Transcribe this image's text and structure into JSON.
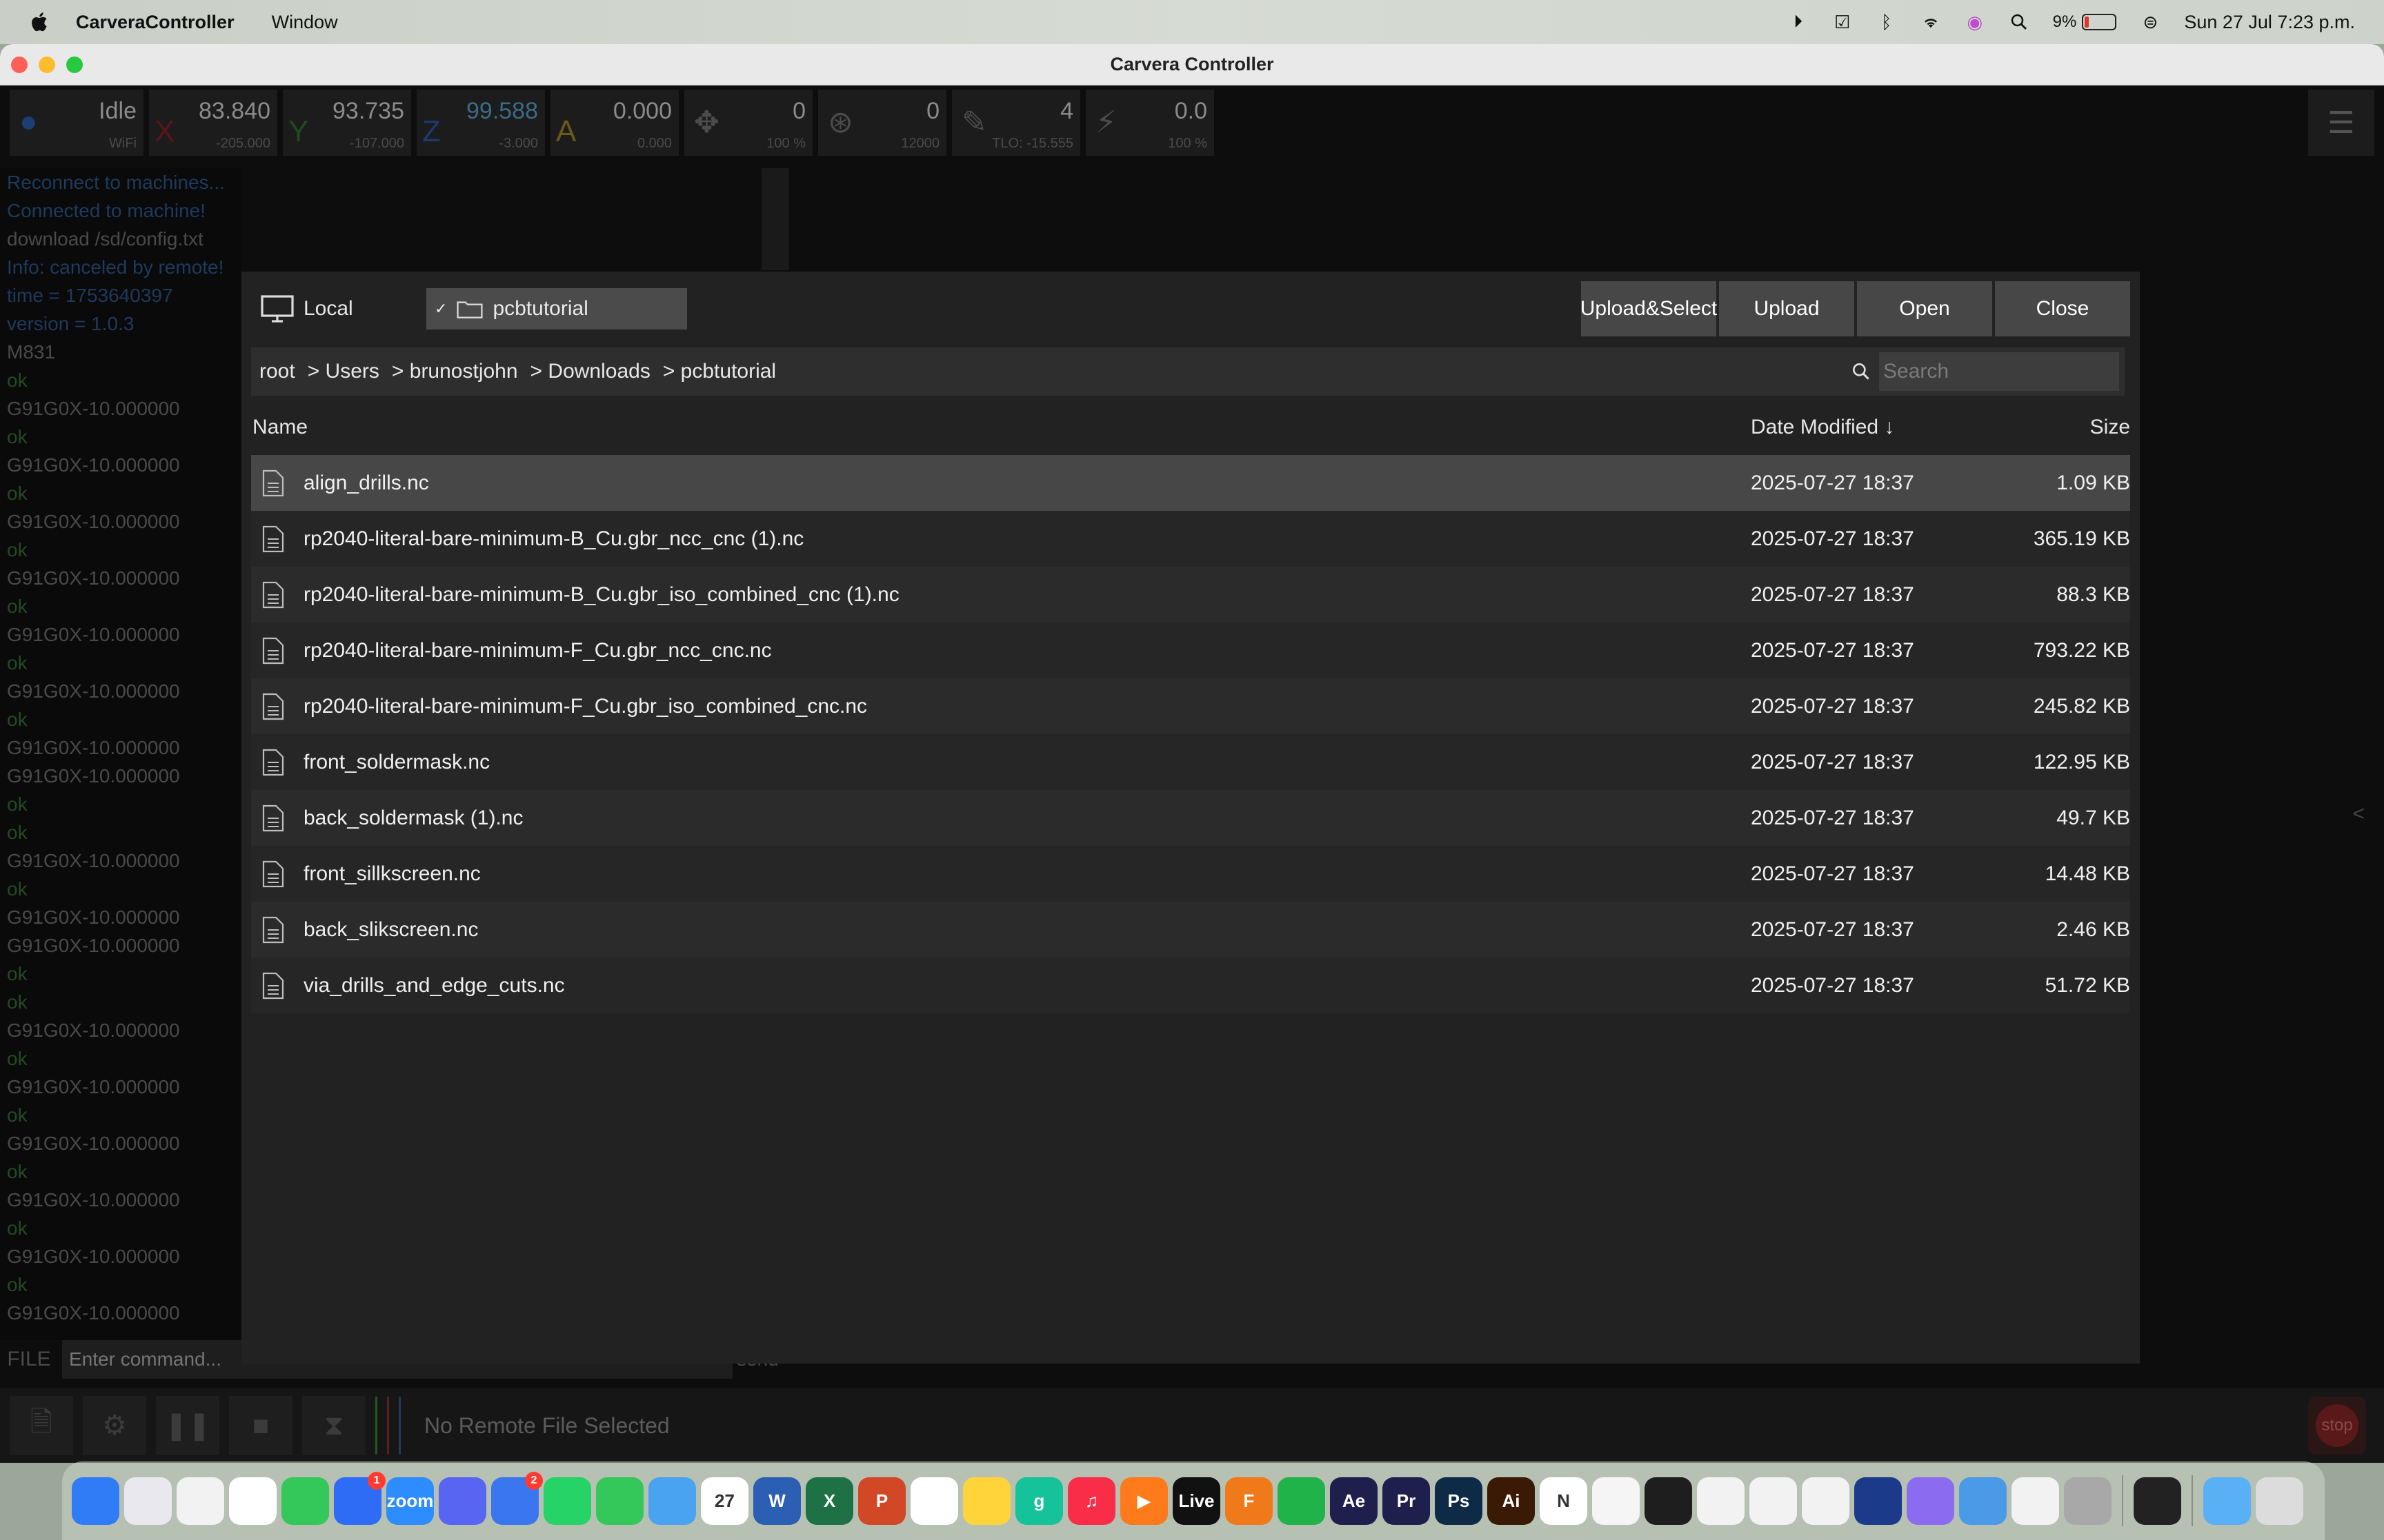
{
  "menubar": {
    "app_name": "CarveraController",
    "menus": [
      "Window"
    ],
    "battery_percent": "9%",
    "clock": "Sun 27 Jul 7:23 p.m."
  },
  "window": {
    "title": "Carvera Controller"
  },
  "status": {
    "state": "Idle",
    "conn": "WiFi",
    "x": {
      "label": "X",
      "value": "83.840",
      "sub": "-205.000"
    },
    "y": {
      "label": "Y",
      "value": "93.735",
      "sub": "-107.000"
    },
    "z": {
      "label": "Z",
      "value": "99.588",
      "sub": "-3.000"
    },
    "a": {
      "label": "A",
      "value": "0.000",
      "sub": "0.000"
    },
    "feed": {
      "value": "0",
      "sub": "100 %"
    },
    "spindle": {
      "value": "0",
      "sub": "12000"
    },
    "tool": {
      "value": "4",
      "sub": "TLO: -15.555"
    },
    "laser": {
      "value": "0.0",
      "sub": "100 %"
    }
  },
  "console": {
    "lines": [
      {
        "t": "Reconnect to machines...",
        "c": "blue"
      },
      {
        "t": "Connected to machine!",
        "c": "blue"
      },
      {
        "t": "download /sd/config.txt",
        "c": ""
      },
      {
        "t": "Info: canceled by remote!",
        "c": "blue"
      },
      {
        "t": "time = 1753640397",
        "c": "blue"
      },
      {
        "t": "version = 1.0.3",
        "c": "blue"
      },
      {
        "t": "M831",
        "c": ""
      },
      {
        "t": "ok",
        "c": "ok"
      },
      {
        "t": "G91G0X-10.000000",
        "c": ""
      },
      {
        "t": "ok",
        "c": "ok"
      },
      {
        "t": "G91G0X-10.000000",
        "c": ""
      },
      {
        "t": "ok",
        "c": "ok"
      },
      {
        "t": "G91G0X-10.000000",
        "c": ""
      },
      {
        "t": "ok",
        "c": "ok"
      },
      {
        "t": "G91G0X-10.000000",
        "c": ""
      },
      {
        "t": "ok",
        "c": "ok"
      },
      {
        "t": "G91G0X-10.000000",
        "c": ""
      },
      {
        "t": "ok",
        "c": "ok"
      },
      {
        "t": "G91G0X-10.000000",
        "c": ""
      },
      {
        "t": "ok",
        "c": "ok"
      },
      {
        "t": "G91G0X-10.000000",
        "c": ""
      },
      {
        "t": "G91G0X-10.000000",
        "c": ""
      },
      {
        "t": "ok",
        "c": "ok"
      },
      {
        "t": "ok",
        "c": "ok"
      },
      {
        "t": "G91G0X-10.000000",
        "c": ""
      },
      {
        "t": "ok",
        "c": "ok"
      },
      {
        "t": "G91G0X-10.000000",
        "c": ""
      },
      {
        "t": "G91G0X-10.000000",
        "c": ""
      },
      {
        "t": "ok",
        "c": "ok"
      },
      {
        "t": "ok",
        "c": "ok"
      },
      {
        "t": "G91G0X-10.000000",
        "c": ""
      },
      {
        "t": "ok",
        "c": "ok"
      },
      {
        "t": "G91G0X-10.000000",
        "c": ""
      },
      {
        "t": "ok",
        "c": "ok"
      },
      {
        "t": "G91G0X-10.000000",
        "c": ""
      },
      {
        "t": "ok",
        "c": "ok"
      },
      {
        "t": "G91G0X-10.000000",
        "c": ""
      },
      {
        "t": "ok",
        "c": "ok"
      },
      {
        "t": "G91G0X-10.000000",
        "c": ""
      },
      {
        "t": "ok",
        "c": "ok"
      },
      {
        "t": "G91G0X-10.000000",
        "c": ""
      }
    ],
    "file_label": "FILE",
    "placeholder": "Enter command...",
    "send_label": "send"
  },
  "bottom": {
    "status_text": "No Remote File Selected",
    "stop_label": "stop"
  },
  "dialog": {
    "location": "Local",
    "folder": "pcbtutorial",
    "buttons": {
      "upload_select": "Upload&Select",
      "upload": "Upload",
      "open": "Open",
      "close": "Close"
    },
    "breadcrumb": [
      "root",
      "> Users",
      "> brunostjohn",
      "> Downloads",
      "> pcbtutorial"
    ],
    "search_placeholder": "Search",
    "columns": {
      "name": "Name",
      "date": "Date Modified ↓",
      "size": "Size"
    },
    "files": [
      {
        "name": "align_drills.nc",
        "date": "2025-07-27 18:37",
        "size": "1.09 KB"
      },
      {
        "name": "rp2040-literal-bare-minimum-B_Cu.gbr_ncc_cnc (1).nc",
        "date": "2025-07-27 18:37",
        "size": "365.19 KB"
      },
      {
        "name": "rp2040-literal-bare-minimum-B_Cu.gbr_iso_combined_cnc (1).nc",
        "date": "2025-07-27 18:37",
        "size": "88.3 KB"
      },
      {
        "name": "rp2040-literal-bare-minimum-F_Cu.gbr_ncc_cnc.nc",
        "date": "2025-07-27 18:37",
        "size": "793.22 KB"
      },
      {
        "name": "rp2040-literal-bare-minimum-F_Cu.gbr_iso_combined_cnc.nc",
        "date": "2025-07-27 18:37",
        "size": "245.82 KB"
      },
      {
        "name": "front_soldermask.nc",
        "date": "2025-07-27 18:37",
        "size": "122.95 KB"
      },
      {
        "name": "back_soldermask (1).nc",
        "date": "2025-07-27 18:37",
        "size": "49.7 KB"
      },
      {
        "name": "front_sillkscreen.nc",
        "date": "2025-07-27 18:37",
        "size": "14.48 KB"
      },
      {
        "name": "back_slikscreen.nc",
        "date": "2025-07-27 18:37",
        "size": "2.46 KB"
      },
      {
        "name": "via_drills_and_edge_cuts.nc",
        "date": "2025-07-27 18:37",
        "size": "51.72 KB"
      }
    ]
  },
  "dock": {
    "apps": [
      {
        "name": "finder",
        "color": "#2f7cf6",
        "label": ""
      },
      {
        "name": "launchpad",
        "color": "#e8e8ee",
        "label": ""
      },
      {
        "name": "freeform",
        "color": "#f2f2f2",
        "label": ""
      },
      {
        "name": "slack",
        "color": "#ffffff",
        "label": ""
      },
      {
        "name": "phone",
        "color": "#34c759",
        "label": ""
      },
      {
        "name": "messenger",
        "color": "#2e6cf5",
        "label": "",
        "badge": "1"
      },
      {
        "name": "zoom",
        "color": "#2d8cff",
        "label": "zoom"
      },
      {
        "name": "discord",
        "color": "#5865f2",
        "label": ""
      },
      {
        "name": "signal",
        "color": "#3a76f0",
        "label": "",
        "badge": "2"
      },
      {
        "name": "whatsapp",
        "color": "#25d366",
        "label": ""
      },
      {
        "name": "messages",
        "color": "#34c759",
        "label": ""
      },
      {
        "name": "testflight",
        "color": "#4aa3f0",
        "label": ""
      },
      {
        "name": "calendar",
        "color": "#ffffff",
        "label": "27"
      },
      {
        "name": "word",
        "color": "#2b5fb4",
        "label": "W"
      },
      {
        "name": "excel",
        "color": "#1e7145",
        "label": "X"
      },
      {
        "name": "powerpoint",
        "color": "#d24726",
        "label": "P"
      },
      {
        "name": "reminders",
        "color": "#ffffff",
        "label": ""
      },
      {
        "name": "notes",
        "color": "#ffd43b",
        "label": ""
      },
      {
        "name": "grammarly",
        "color": "#15c39a",
        "label": "g"
      },
      {
        "name": "music",
        "color": "#fa2d48",
        "label": "♫"
      },
      {
        "name": "infuse",
        "color": "#ff7a1a",
        "label": "▶"
      },
      {
        "name": "ableton-live",
        "color": "#111111",
        "label": "Live"
      },
      {
        "name": "fusion",
        "color": "#f07a1a",
        "label": "F"
      },
      {
        "name": "numbers",
        "color": "#20b34a",
        "label": ""
      },
      {
        "name": "after-effects",
        "color": "#1f1f4d",
        "label": "Ae"
      },
      {
        "name": "premiere",
        "color": "#1f1f4d",
        "label": "Pr"
      },
      {
        "name": "photoshop",
        "color": "#0f2a47",
        "label": "Ps"
      },
      {
        "name": "illustrator",
        "color": "#3a1a05",
        "label": "Ai"
      },
      {
        "name": "notion",
        "color": "#ffffff",
        "label": "N"
      },
      {
        "name": "app-capsule",
        "color": "#f5f5f5",
        "label": ""
      },
      {
        "name": "figma",
        "color": "#1e1e1e",
        "label": ""
      },
      {
        "name": "app-striped",
        "color": "#f2f2f2",
        "label": ""
      },
      {
        "name": "app-pen",
        "color": "#f2f2f2",
        "label": ""
      },
      {
        "name": "app-cube",
        "color": "#f2f2f2",
        "label": ""
      },
      {
        "name": "app-device",
        "color": "#1b3a8a",
        "label": ""
      },
      {
        "name": "app-purple",
        "color": "#8b6cf0",
        "label": ""
      },
      {
        "name": "app-blue-square",
        "color": "#4b9ae8",
        "label": ""
      },
      {
        "name": "app-gear-square",
        "color": "#f2f2f2",
        "label": ""
      },
      {
        "name": "system-settings",
        "color": "#a8a8a8",
        "label": ""
      },
      {
        "name": "carvera-controller",
        "color": "#222222",
        "label": ""
      },
      {
        "name": "downloads-folder",
        "color": "#5ab0f5",
        "label": ""
      },
      {
        "name": "trash",
        "color": "#dcdcdc",
        "label": ""
      }
    ]
  }
}
